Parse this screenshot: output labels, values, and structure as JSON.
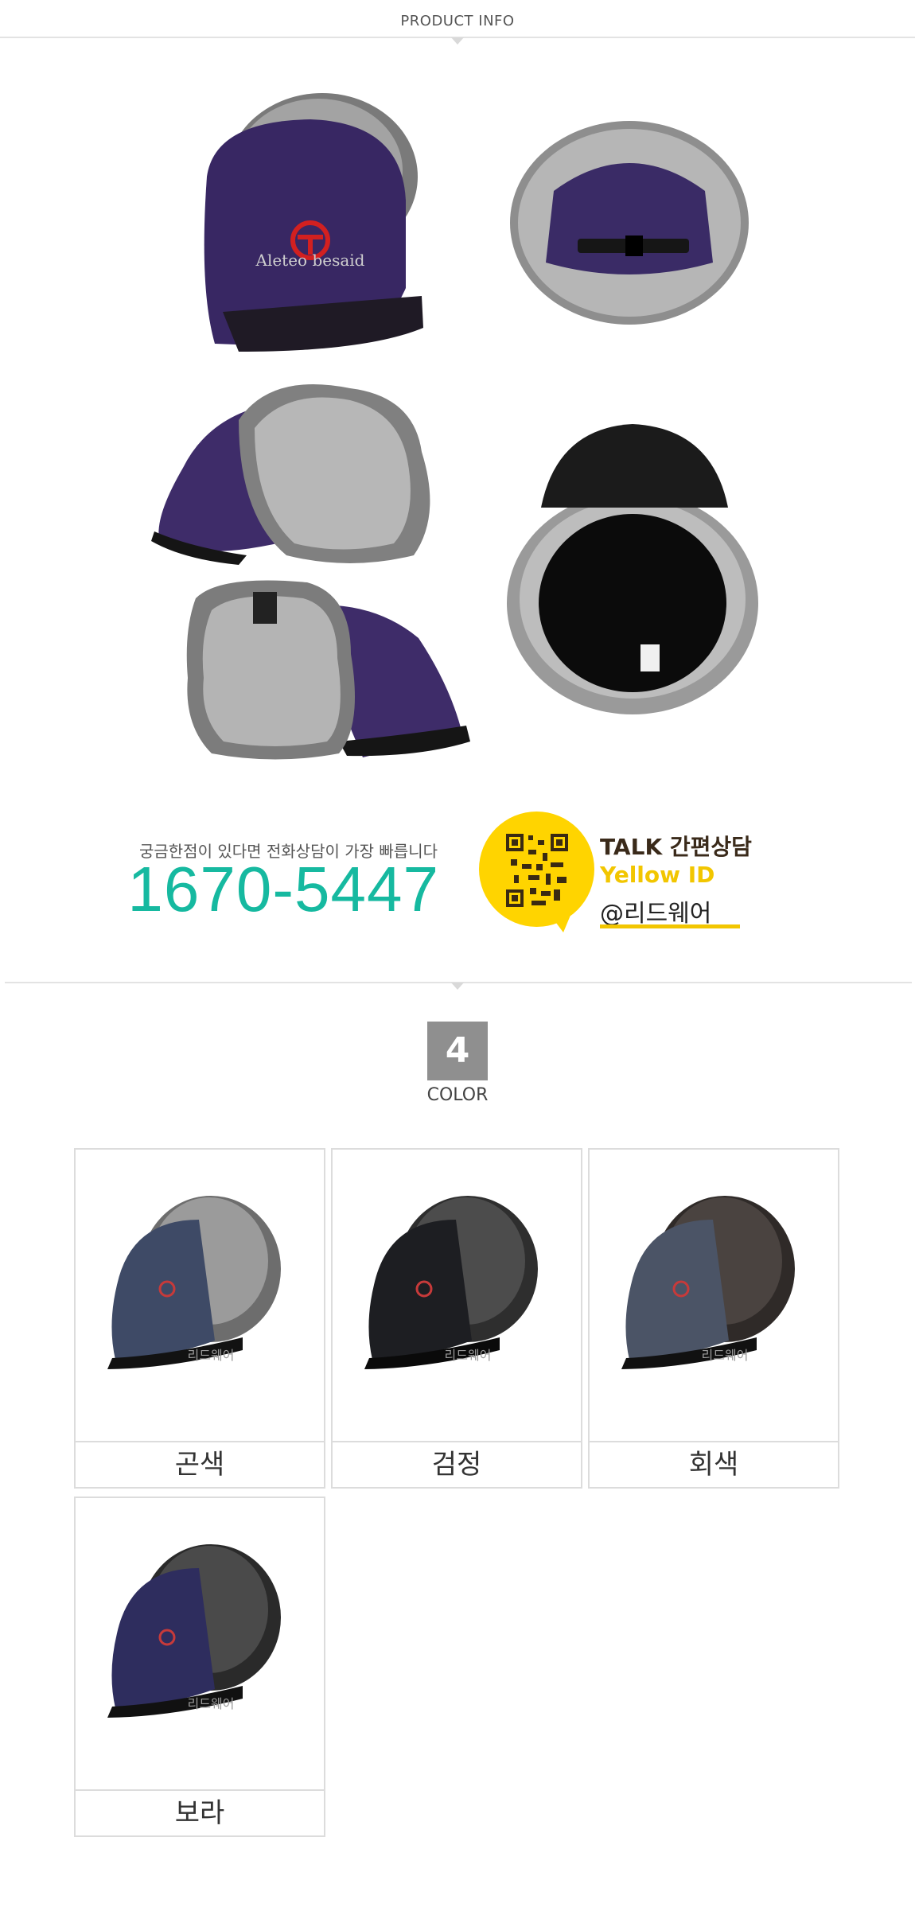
{
  "header": {
    "title": "PRODUCT INFO"
  },
  "product": {
    "logo_text": "Aleteo besaid"
  },
  "contact": {
    "question": "궁금한점이 있다면 전화상담이 가장 빠릅니다",
    "phone": "1670-5447",
    "talk_title": "TALK 간편상담",
    "talk_subtitle": "Yellow ID",
    "talk_id": "@리드웨어"
  },
  "color_section": {
    "count": "4",
    "title": "COLOR",
    "watermark": "리드웨어",
    "swatches": [
      {
        "label": "곤색",
        "fabric": "#3f4b67",
        "fur": "#7d7d7d"
      },
      {
        "label": "검정",
        "fabric": "#1f2024",
        "fur": "#424242"
      },
      {
        "label": "회색",
        "fabric": "#4d5667",
        "fur": "#3f3a38"
      },
      {
        "label": "보라",
        "fabric": "#2f2e5f",
        "fur": "#3d3d3d"
      }
    ]
  },
  "colors": {
    "accent_phone": "#16b9a0",
    "kakao_yellow": "#ffd400",
    "purple_fabric": "#3b2a66",
    "fur_gray": "#8a8a8a"
  }
}
